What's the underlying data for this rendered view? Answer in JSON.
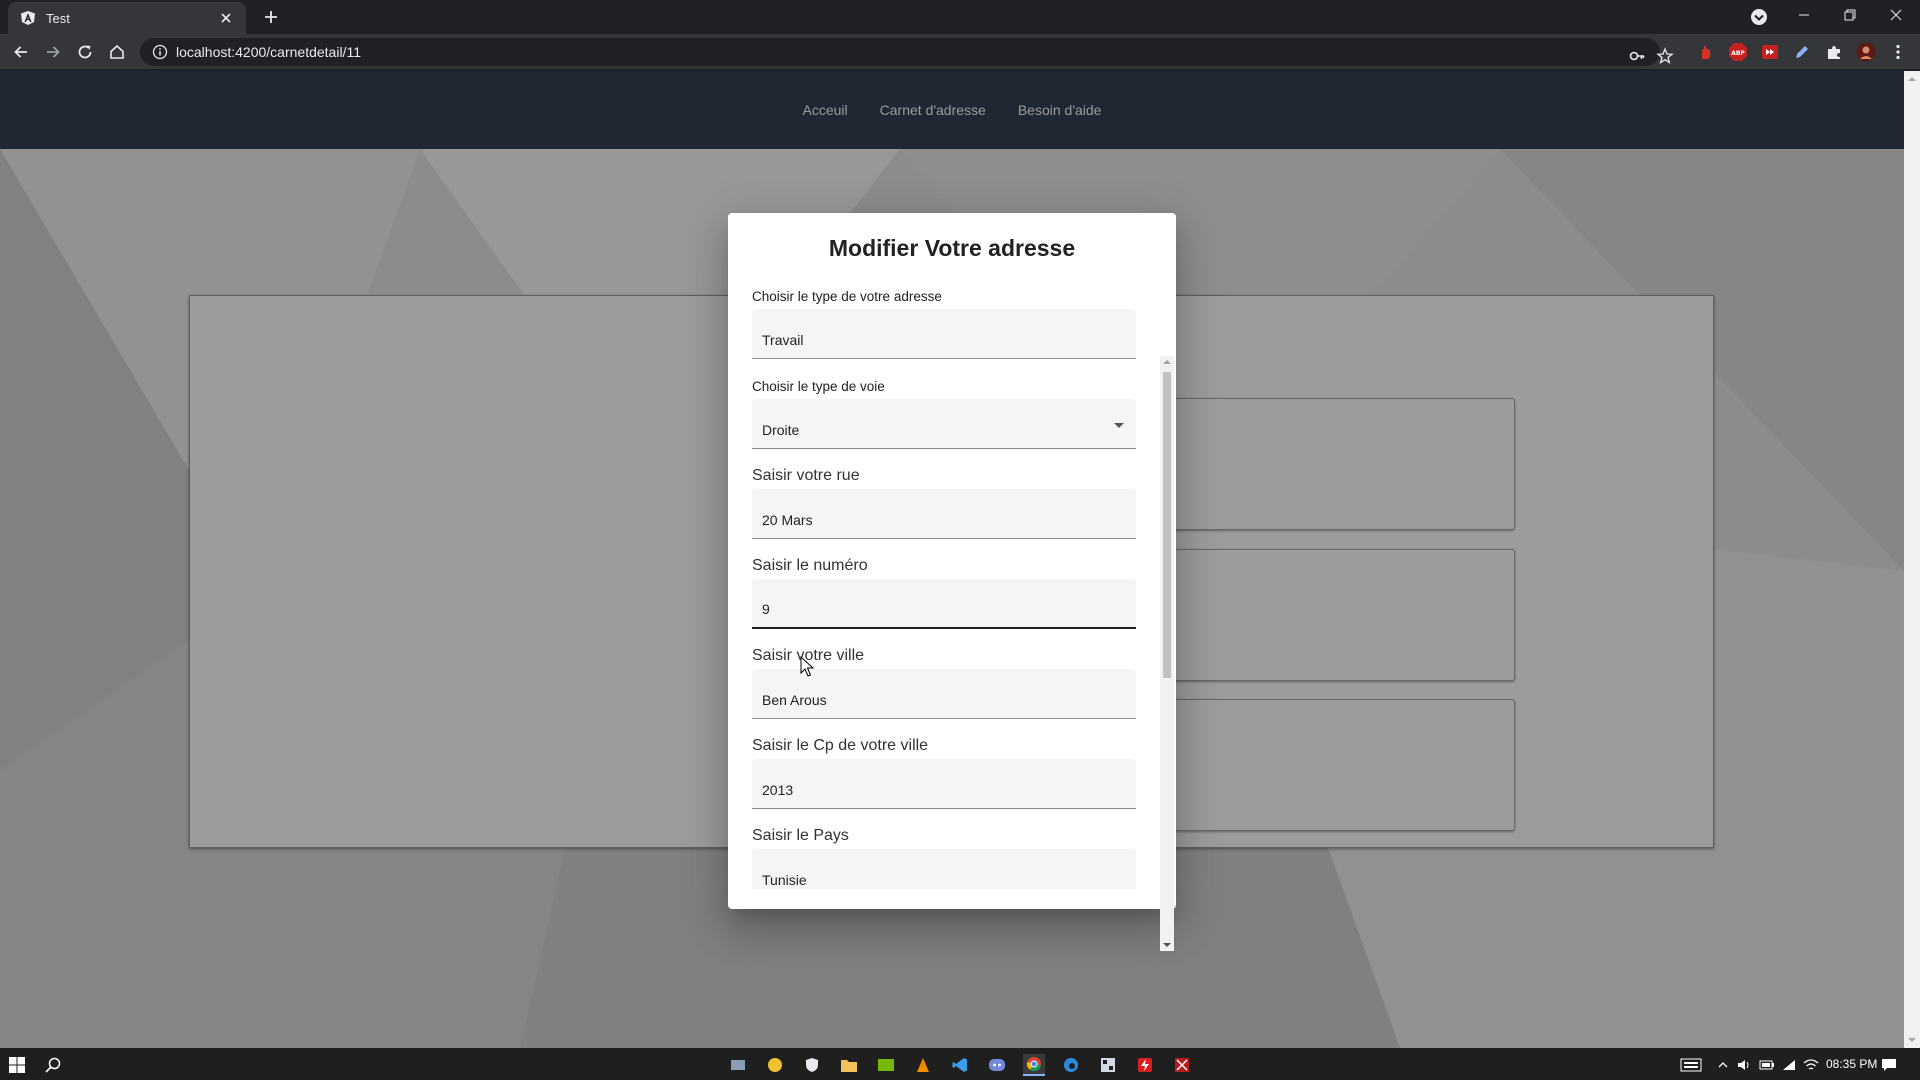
{
  "browser": {
    "tab_title": "Test",
    "url": "localhost:4200/carnetdetail/11",
    "colors": {
      "frame": "#202124",
      "toolbar": "#35363a"
    }
  },
  "navbar": {
    "links": [
      "Acceuil",
      "Carnet d'adresse",
      "Besoin d'aide"
    ],
    "colors": {
      "background": "#2f3b4a"
    }
  },
  "cards": [
    {
      "delete_icon": "trash-icon",
      "edit_icon": "pencil-icon"
    },
    {
      "delete_icon": "trash-icon",
      "edit_icon": "pencil-icon"
    },
    {
      "delete_icon": "trash-icon",
      "edit_icon": "pencil-icon"
    }
  ],
  "dialog": {
    "title": "Modifier Votre adresse",
    "fields": [
      {
        "label": "Choisir le type de votre adresse",
        "value": "Travail"
      },
      {
        "label": "Choisir le type de voie",
        "value": "Droite"
      },
      {
        "label": "Saisir votre rue",
        "value": "20 Mars"
      },
      {
        "label": "Saisir le numéro",
        "value": "9"
      },
      {
        "label": "Saisir votre ville",
        "value": "Ben Arous"
      },
      {
        "label": "Saisir le Cp de votre ville",
        "value": "2013"
      },
      {
        "label": "Saisir le Pays",
        "value": "Tunisie"
      }
    ]
  },
  "taskbar": {
    "clock": "08:35 PM"
  },
  "colors": {
    "delete": "#c0121b",
    "edit": "#1e7a1e",
    "dialog_bg": "#ffffff"
  }
}
